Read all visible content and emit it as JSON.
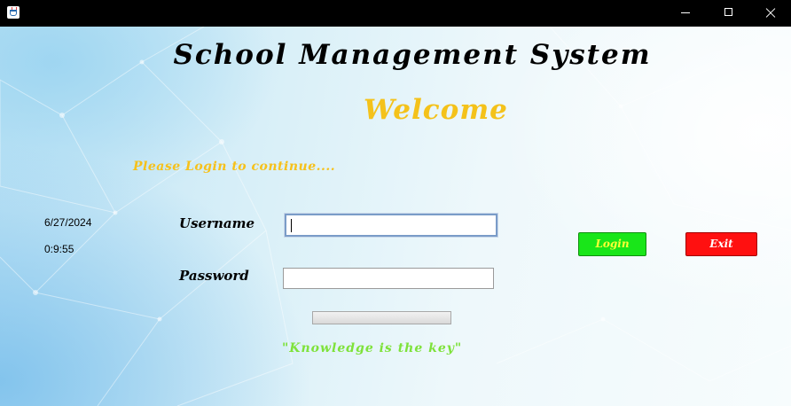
{
  "window": {
    "icon": "java-cup-icon",
    "controls": [
      "minimize",
      "maximize",
      "close"
    ]
  },
  "header": {
    "title": "School Management System",
    "welcome": "Welcome",
    "prompt": "Please Login to continue...."
  },
  "clock": {
    "date": "6/27/2024",
    "time": "0:9:55"
  },
  "form": {
    "username_label": "Username",
    "username_value": "",
    "password_label": "Password",
    "password_value": "",
    "progress": 0
  },
  "buttons": {
    "login_label": "Login",
    "exit_label": "Exit"
  },
  "footer": {
    "motto": "\"Knowledge is the key\""
  },
  "colors": {
    "title": "#000000",
    "welcome": "#f4c21a",
    "prompt": "#f6c11b",
    "motto": "#7ee23a",
    "login_button": "#19e619",
    "login_text": "#ffff33",
    "exit_button": "#ff1010",
    "exit_text": "#ffffff"
  }
}
